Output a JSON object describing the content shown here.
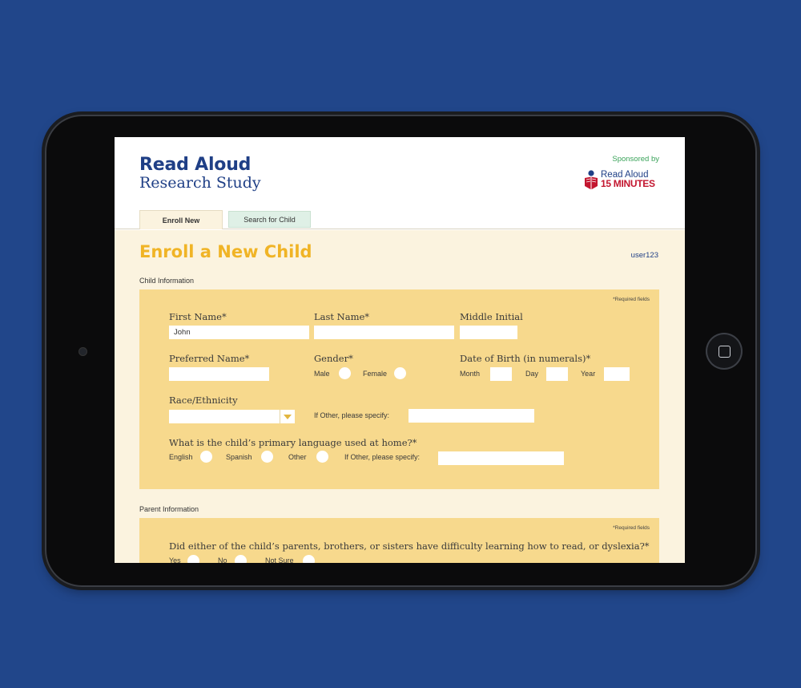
{
  "header": {
    "brand_title": "Read Aloud",
    "brand_subtitle": "Research Study",
    "sponsor_text": "Sponsored by",
    "sponsor_logo_line1": "Read Aloud",
    "sponsor_logo_line2": "15 MINUTES"
  },
  "tabs": [
    {
      "label": "Enroll New"
    },
    {
      "label": "Search for Child"
    }
  ],
  "page": {
    "title": "Enroll a New Child",
    "user": "user123"
  },
  "child_section": {
    "label": "Child Information",
    "required_note": "*Required fields",
    "first_name_label": "First Name*",
    "first_name_value": "John",
    "last_name_label": "Last Name*",
    "middle_initial_label": "Middle Initial",
    "preferred_name_label": "Preferred Name*",
    "gender_label": "Gender*",
    "gender_male": "Male",
    "gender_female": "Female",
    "dob_label": "Date of Birth (in numerals)*",
    "dob_month": "Month",
    "dob_day": "Day",
    "dob_year": "Year",
    "race_label": "Race/Ethnicity",
    "race_other_label": "If Other, please specify:",
    "language_question": "What is the child’s primary language used at home?*",
    "lang_english": "English",
    "lang_spanish": "Spanish",
    "lang_other": "Other",
    "lang_other_label": "If Other, please specify:"
  },
  "parent_section": {
    "label": "Parent Information",
    "required_note": "*Required fields",
    "question": "Did either of the child’s parents, brothers, or sisters have difficulty learning how to read, or dyslexia?*",
    "opt_yes": "Yes",
    "opt_no": "No",
    "opt_not_sure": "Not Sure"
  },
  "colors": {
    "background": "#21468a",
    "brand_blue": "#1f3f86",
    "title_gold": "#f0b426",
    "panel": "#f7d98d",
    "page_bg": "#fbf3df",
    "sponsor_green": "#3aa35a",
    "logo_red": "#c3162f"
  }
}
